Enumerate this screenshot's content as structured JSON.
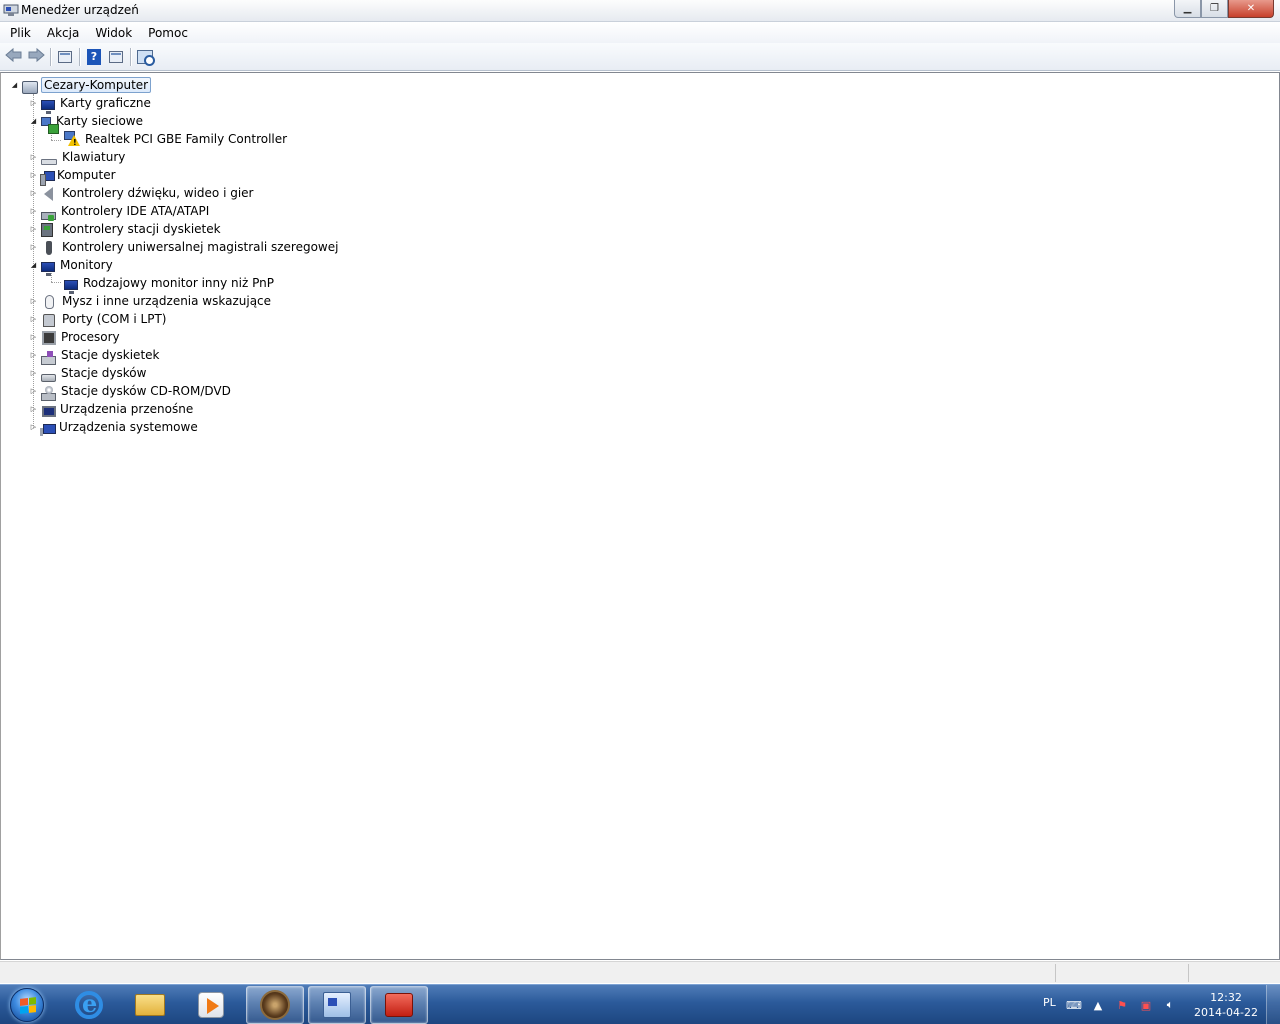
{
  "window": {
    "title": "Menedżer urządzeń",
    "minimize": "▁",
    "maximize": "❐",
    "close": "✕"
  },
  "menu": [
    "Plik",
    "Akcja",
    "Widok",
    "Pomoc"
  ],
  "toolbar": {
    "back_icon": "back-arrow-icon",
    "forward_icon": "forward-arrow-icon",
    "help_label": "?"
  },
  "tree": {
    "root": "Cezary-Komputer",
    "nodes": [
      {
        "label": "Karty graficzne",
        "icon": "display-adapter-icon",
        "expanded": false
      },
      {
        "label": "Karty sieciowe",
        "icon": "network-adapter-icon",
        "expanded": true,
        "children": [
          {
            "label": "Realtek PCI GBE Family Controller",
            "icon": "warning-network-icon"
          }
        ]
      },
      {
        "label": "Klawiatury",
        "icon": "keyboard-icon",
        "expanded": false
      },
      {
        "label": "Komputer",
        "icon": "computer-icon",
        "expanded": false
      },
      {
        "label": "Kontrolery dźwięku, wideo i gier",
        "icon": "speaker-icon",
        "expanded": false
      },
      {
        "label": "Kontrolery IDE ATA/ATAPI",
        "icon": "ide-controller-icon",
        "expanded": false
      },
      {
        "label": "Kontrolery stacji dyskietek",
        "icon": "floppy-controller-icon",
        "expanded": false
      },
      {
        "label": "Kontrolery uniwersalnej magistrali szeregowej",
        "icon": "usb-icon",
        "expanded": false
      },
      {
        "label": "Monitory",
        "icon": "monitor-icon",
        "expanded": true,
        "children": [
          {
            "label": "Rodzajowy monitor inny niż PnP",
            "icon": "monitor-icon"
          }
        ]
      },
      {
        "label": "Mysz i inne urządzenia wskazujące",
        "icon": "mouse-icon",
        "expanded": false
      },
      {
        "label": "Porty (COM i LPT)",
        "icon": "port-icon",
        "expanded": false
      },
      {
        "label": "Procesory",
        "icon": "cpu-icon",
        "expanded": false
      },
      {
        "label": "Stacje dyskietek",
        "icon": "floppy-drive-icon",
        "expanded": false
      },
      {
        "label": "Stacje dysków",
        "icon": "disk-drive-icon",
        "expanded": false
      },
      {
        "label": "Stacje dysków CD-ROM/DVD",
        "icon": "cdrom-icon",
        "expanded": false
      },
      {
        "label": "Urządzenia przenośne",
        "icon": "portable-device-icon",
        "expanded": false
      },
      {
        "label": "Urządzenia systemowe",
        "icon": "system-device-icon",
        "expanded": false
      }
    ]
  },
  "taskbar": {
    "language": "PL",
    "time": "12:32",
    "date": "2014-04-22"
  }
}
